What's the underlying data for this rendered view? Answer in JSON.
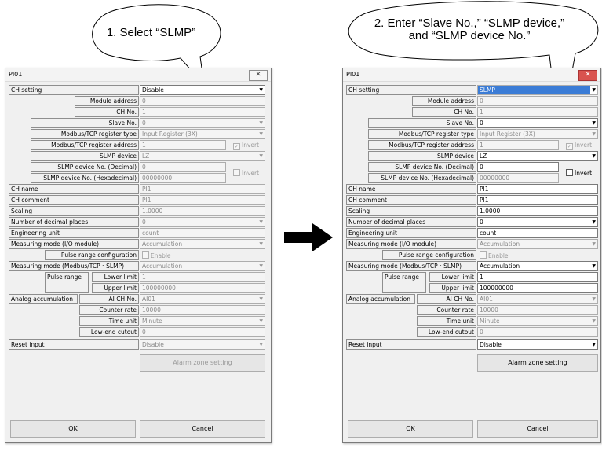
{
  "callout_left": "1. Select “SLMP”",
  "callout_right_line1": "2. Enter “Slave No.,” “SLMP device,”",
  "callout_right_line2": "and “SLMP device No.”",
  "arrow_color": "#000000",
  "dialog_title": "PI01",
  "close_symbol": "✕",
  "labels": {
    "ch_setting": "CH setting",
    "module_address": "Module address",
    "ch_no": "CH No.",
    "slave_no": "Slave No.",
    "modbus_register_type": "Modbus/TCP register type",
    "modbus_register_address": "Modbus/TCP register address",
    "slmp_device": "SLMP device",
    "slmp_device_no_dec": "SLMP device No. (Decimal)",
    "slmp_device_no_hex": "SLMP device No. (Hexadecimal)",
    "ch_name": "CH name",
    "ch_comment": "CH comment",
    "scaling": "Scaling",
    "decimal_places": "Number of decimal places",
    "engineering_unit": "Engineering unit",
    "measuring_mode_io": "Measuring mode (I/O module)",
    "pulse_range_config": "Pulse range configuration",
    "measuring_mode_modbus": "Measuring mode (Modbus/TCP・SLMP)",
    "pulse_range": "Pulse range",
    "lower_limit": "Lower limit",
    "upper_limit": "Upper limit",
    "analog_accumulation": "Analog accumulation",
    "ai_ch_no": "AI CH No.",
    "counter_rate": "Counter rate",
    "time_unit": "Time unit",
    "low_end_cutoff": "Low-end cutout",
    "reset_input": "Reset input",
    "invert": "Invert",
    "enable": "Enable"
  },
  "left": {
    "ch_setting": "Disable",
    "module_address": "0",
    "ch_no": "1",
    "slave_no": "0",
    "register_type": "Input Register (3X)",
    "register_address": "1",
    "slmp_device": "LZ",
    "dev_dec": "0",
    "dev_hex": "00000000",
    "ch_name": "PI1",
    "ch_comment": "PI1",
    "scaling": "1.0000",
    "decimal_places": "0",
    "eng_unit": "count",
    "mode_io": "Accumulation",
    "mode_modbus": "Accumulation",
    "lower_limit": "1",
    "upper_limit": "100000000",
    "ai_ch_no": "AI01",
    "counter_rate": "10000",
    "time_unit": "Minute",
    "cutoff": "0",
    "reset_input": "Disable"
  },
  "right": {
    "ch_setting": "SLMP",
    "module_address": "0",
    "ch_no": "1",
    "slave_no": "0",
    "register_type": "Input Register (3X)",
    "register_address": "1",
    "slmp_device": "LZ",
    "dev_dec": "0",
    "dev_hex": "00000000",
    "ch_name": "PI1",
    "ch_comment": "PI1",
    "scaling": "1.0000",
    "decimal_places": "0",
    "eng_unit": "count",
    "mode_io": "Accumulation",
    "mode_modbus": "Accumulation",
    "lower_limit": "1",
    "upper_limit": "100000000",
    "ai_ch_no": "AI01",
    "counter_rate": "10000",
    "time_unit": "Minute",
    "cutoff": "0",
    "reset_input": "Disable"
  },
  "buttons": {
    "alarm": "Alarm zone setting",
    "ok": "OK",
    "cancel": "Cancel"
  }
}
